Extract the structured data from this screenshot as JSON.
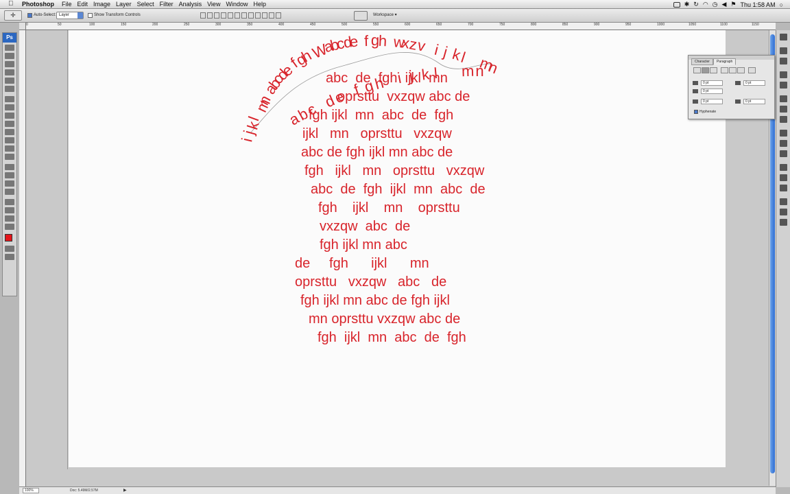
{
  "menubar": {
    "apple": "",
    "app_name": "Photoshop",
    "menus": [
      "File",
      "Edit",
      "Image",
      "Layer",
      "Select",
      "Filter",
      "Analysis",
      "View",
      "Window",
      "Help"
    ],
    "clock": "Thu 1:58 AM"
  },
  "options_bar": {
    "auto_select_label": "Auto-Select:",
    "auto_select_value": "Layer",
    "transform_label": "Show Transform Controls",
    "workspace_label": "Workspace ▾"
  },
  "toolbox": {
    "logo": "Ps",
    "foreground_color": "#e4151a"
  },
  "ruler_ticks": [
    "0",
    "50",
    "100",
    "150",
    "200",
    "250",
    "300",
    "350",
    "400",
    "450",
    "500",
    "550",
    "600",
    "650",
    "700",
    "750",
    "800",
    "850",
    "900",
    "950",
    "1000",
    "1050",
    "1100",
    "1150"
  ],
  "paragraph_panel": {
    "tabs": [
      "Character",
      "Paragraph"
    ],
    "active_tab": "Paragraph",
    "indent_left": "0 pt",
    "indent_right": "0 pt",
    "indent_first": "0 pt",
    "space_before": "0 pt",
    "space_after": "0 pt",
    "hyphenate_label": "Hyphenate"
  },
  "status_bar": {
    "zoom": "100%",
    "doc_size": "Doc: 5.49M/2.57M",
    "arrow": "▶"
  },
  "text_color": "#d8242b",
  "paragraph_lines": [
    "abc  de  fgh  ijkl  mn",
    "oprsttu  vxzqw abc de",
    "fgh ijkl  mn  abc  de  fgh",
    "ijkl   mn   oprsttu   vxzqw",
    "abc de fgh ijkl mn abc de",
    "fgh   ijkl   mn   oprsttu   vxzqw",
    "abc  de  fgh  ijkl  mn  abc  de",
    "fgh    ijkl    mn    oprsttu",
    "vxzqw  abc  de",
    "fgh ijkl mn abc",
    "de     fgh      ijkl      mn",
    "oprsttu   vxzqw   abc   de",
    "fgh ijkl mn abc de fgh ijkl",
    "mn oprsttu vxzqw abc de",
    "fgh  ijkl  mn  abc  de  fgh"
  ],
  "arc_text_outer": "ijkl mn abcde fgh W abcde fgh wxzv ijkl mn",
  "arc_text_inner": "abc de fgh ijkl mn"
}
